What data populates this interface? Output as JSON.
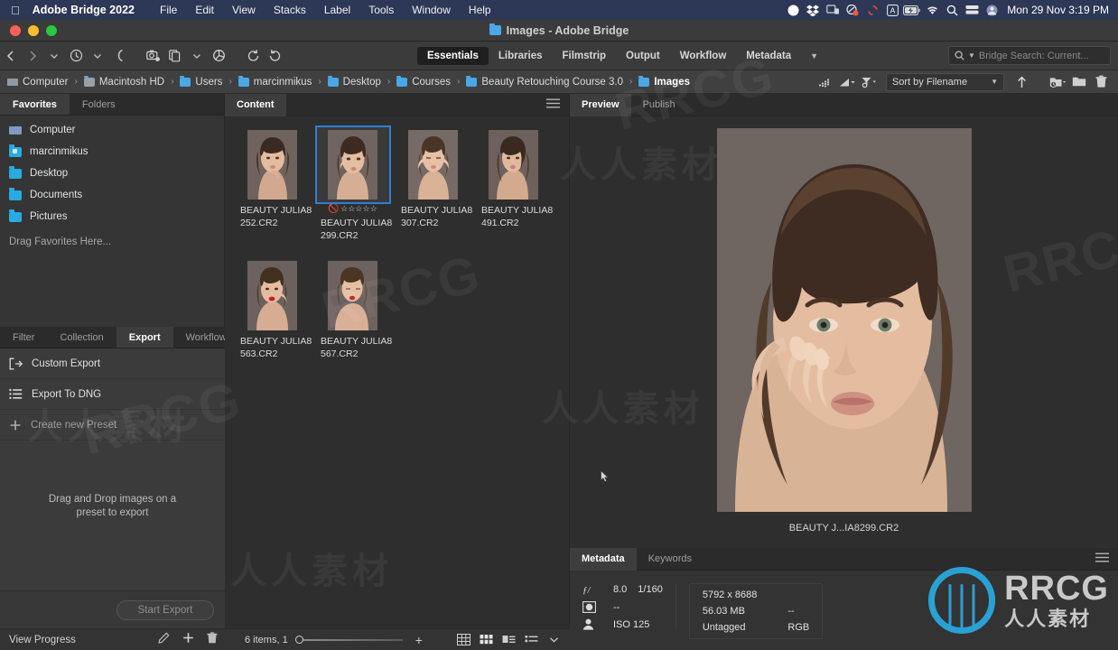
{
  "menubar": {
    "apple_icon": "apple-icon",
    "app_name": "Adobe Bridge 2022",
    "items": [
      "File",
      "Edit",
      "View",
      "Stacks",
      "Label",
      "Tools",
      "Window",
      "Help"
    ],
    "status_icons": [
      "record-icon",
      "dropbox-icon",
      "screen-lock-icon",
      "cleanmymac-icon",
      "sync-icon",
      "keyboard-input-icon",
      "battery-icon",
      "wifi-icon",
      "spotlight-search-icon",
      "timemachine-icon",
      "user-avatar-icon"
    ],
    "clock": "Mon 29 Nov  3:19 PM"
  },
  "window": {
    "title": "Images - Adobe Bridge",
    "folder_icon": "folder-icon"
  },
  "toolbar": {
    "nav_icons": [
      "back-arrow-icon",
      "forward-arrow-icon",
      "chevron-down-icon",
      "recent-history-icon",
      "chevron-down-icon",
      "boomerang-icon"
    ],
    "action_icons": [
      "get-photos-from-camera-icon",
      "refine-icon",
      "chevron-down-icon",
      "open-in-camera-raw-icon"
    ],
    "rotate_icons": [
      "rotate-counterclockwise-icon",
      "rotate-clockwise-icon"
    ],
    "workspaces": [
      "Essentials",
      "Libraries",
      "Filmstrip",
      "Output",
      "Workflow",
      "Metadata"
    ],
    "active_workspace": "Essentials",
    "overflow_icon": "chevron-down-icon",
    "search": {
      "icon": "search-icon",
      "dropdown_icon": "chevron-down-icon",
      "placeholder": "Bridge Search: Current..."
    }
  },
  "pathbar": {
    "crumbs": [
      {
        "label": "Computer",
        "icon": "computer-icon"
      },
      {
        "label": "Macintosh HD",
        "icon": "harddisk-icon"
      },
      {
        "label": "Users",
        "icon": "folder-icon"
      },
      {
        "label": "marcinmikus",
        "icon": "home-folder-icon"
      },
      {
        "label": "Desktop",
        "icon": "folder-icon"
      },
      {
        "label": "Courses",
        "icon": "folder-icon"
      },
      {
        "label": "Beauty Retouching Course 3.0",
        "icon": "folder-icon"
      },
      {
        "label": "Images",
        "icon": "folder-icon"
      }
    ],
    "separator": "›",
    "right_icons": [
      "filter-rating-icon",
      "filter-rating-dropdown-icon",
      "filter-funnel-icon",
      "filter-funnel-caret-icon"
    ],
    "sort": {
      "label": "Sort by Filename",
      "caret_icon": "chevron-down-icon",
      "ascending_icon": "arrow-up-icon"
    },
    "tail_icons": [
      "new-subfolder-icon",
      "new-folder-icon",
      "delete-icon"
    ]
  },
  "left_panel": {
    "tabs": [
      "Favorites",
      "Folders"
    ],
    "active_tab": "Favorites",
    "favorites": [
      {
        "label": "Computer",
        "icon": "computer-icon"
      },
      {
        "label": "marcinmikus",
        "icon": "home-folder-icon"
      },
      {
        "label": "Desktop",
        "icon": "folder-icon"
      },
      {
        "label": "Documents",
        "icon": "folder-icon"
      },
      {
        "label": "Pictures",
        "icon": "folder-icon"
      }
    ],
    "drag_hint": "Drag Favorites Here...",
    "bottom_tabs": [
      "Filter",
      "Collection",
      "Export",
      "Workflow"
    ],
    "bottom_active_tab": "Export",
    "export_rows": [
      {
        "label": "Custom Export",
        "icon": "export-arrow-icon"
      },
      {
        "label": "Export To DNG",
        "icon": "list-icon"
      },
      {
        "label": "Create new Preset",
        "icon": "plus-icon"
      }
    ],
    "drop_message_line1": "Drag and Drop images on a",
    "drop_message_line2": "preset to export",
    "start_export_label": "Start Export",
    "view_progress_label": "View Progress",
    "status_icons": [
      "edit-pencil-icon",
      "plus-icon",
      "trash-icon"
    ]
  },
  "content_panel": {
    "tab": "Content",
    "menu_icon": "hamburger-menu-icon",
    "items": [
      {
        "name_line1": "BEAUTY JULIA8",
        "name_line2": "252.CR2",
        "selected": false,
        "rating_visible": false
      },
      {
        "name_line1": "BEAUTY JULIA8",
        "name_line2": "299.CR2",
        "selected": true,
        "rating_visible": true
      },
      {
        "name_line1": "BEAUTY JULIA8",
        "name_line2": "307.CR2",
        "selected": false,
        "rating_visible": false
      },
      {
        "name_line1": "BEAUTY JULIA8",
        "name_line2": "491.CR2",
        "selected": false,
        "rating_visible": false
      },
      {
        "name_line1": "BEAUTY JULIA8",
        "name_line2": "563.CR2",
        "selected": false,
        "rating_visible": false
      },
      {
        "name_line1": "BEAUTY JULIA8",
        "name_line2": "567.CR2",
        "selected": false,
        "rating_visible": false
      }
    ],
    "rating": {
      "reject_icon": "no-rating-icon",
      "stars": "☆☆☆☆☆"
    },
    "status": {
      "count_label": "6 items, 1",
      "thumbnail_slider_icon": "thumbnail-size-slider",
      "zoom_in_icon": "plus-icon",
      "view_modes": [
        "grid-view-icon",
        "thumbnail-view-icon",
        "details-view-icon",
        "list-view-icon",
        "chevron-down-icon"
      ]
    }
  },
  "right_panel": {
    "preview_tabs": [
      "Preview",
      "Publish"
    ],
    "preview_active": "Preview",
    "preview_caption": "BEAUTY J...IA8299.CR2",
    "metadata_tabs": [
      "Metadata",
      "Keywords"
    ],
    "metadata_active": "Metadata",
    "metadata_menu_icon": "hamburger-menu-icon",
    "metadata": {
      "aperture_icon": "aperture-f-icon",
      "aperture": "8.0",
      "shutter": "1/160",
      "metering_icon": "metering-mode-icon",
      "metering": "--",
      "person_icon": "person-icon",
      "iso": "ISO 125",
      "dimensions": "5792 x 8688",
      "filesize": "56.03 MB",
      "filesize_extra": "--",
      "colorprofile": "Untagged",
      "colormode": "RGB"
    }
  },
  "watermarks": {
    "chinese": "人人素材",
    "english": "RRCG",
    "logo_main": "RRCG",
    "logo_sub": "人人素材"
  },
  "colors": {
    "accent_blue": "#29abe2",
    "selection_blue": "#2f7fd1",
    "menubar_bg": "#2d3756",
    "panel_bg": "#353535",
    "content_bg": "#2e2e2e"
  }
}
